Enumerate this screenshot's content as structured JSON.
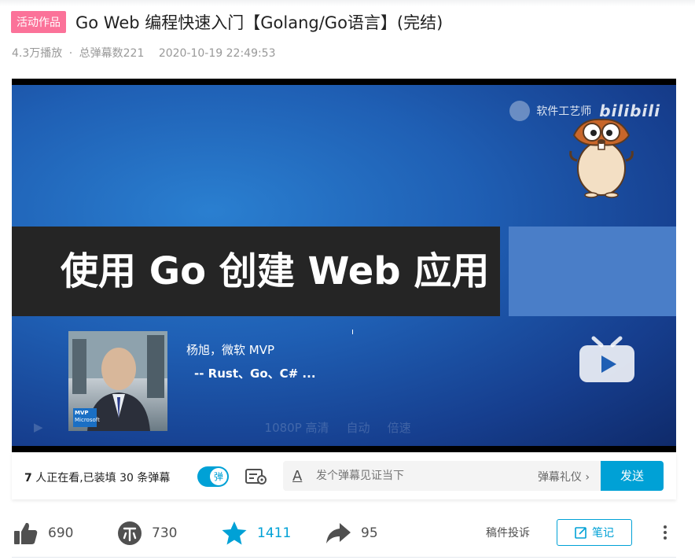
{
  "video": {
    "badge": "活动作品",
    "title": "Go Web 编程快速入门【Golang/Go语言】(完结)",
    "plays": "4.3万播放",
    "separator": "·",
    "danmaku_total": "总弹幕数221",
    "date": "2020-10-19 22:49:53"
  },
  "player": {
    "uploader_watermark": "软件工艺师",
    "site_logo": "bilibili",
    "slide_title": "使用 Go 创建 Web 应用",
    "author_name": "杨旭，微软 MVP",
    "author_sub": "-- Rust、Go、C# ...",
    "mvp_badge": "MVP",
    "mvp_text": "Microsoft",
    "faint_controls": [
      "1080P 高清",
      "自动",
      "倍速"
    ]
  },
  "sendbar": {
    "viewer_count": "7",
    "viewer_text": " 人正在看,已装填 30 条弹幕",
    "toggle_label": "弹",
    "input_placeholder": "发个弹幕见证当下",
    "etiquette": "弹幕礼仪 ›",
    "send": "发送"
  },
  "actions": {
    "like": "690",
    "coin": "730",
    "favorite": "1411",
    "share": "95",
    "report": "稿件投诉",
    "note": "笔记"
  },
  "colors": {
    "accent": "#00a1d6",
    "badge": "#fb7299"
  },
  "icons": [
    "thumb-up-icon",
    "coin-icon",
    "star-icon",
    "share-icon",
    "note-icon",
    "more-icon",
    "danmaku-settings-icon",
    "font-icon",
    "tv-play-icon"
  ]
}
